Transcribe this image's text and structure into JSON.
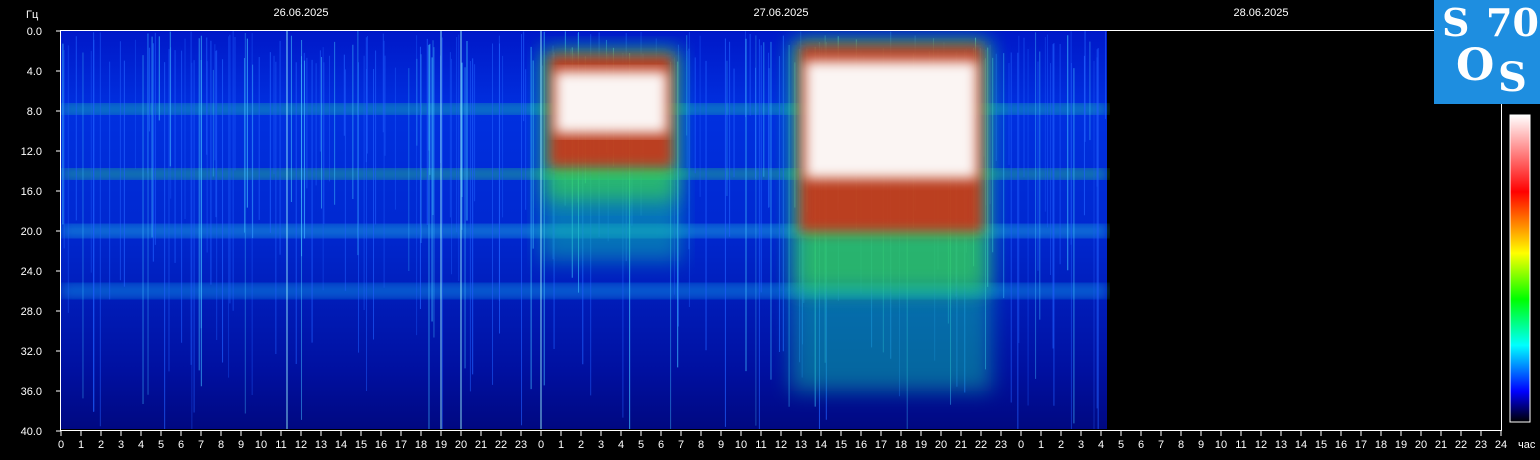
{
  "chart_data": {
    "type": "heatmap",
    "ylabel": "Гц",
    "xlabel": "час",
    "yticks": [
      "0.0",
      "4.0",
      "8.0",
      "12.0",
      "16.0",
      "20.0",
      "24.0",
      "28.0",
      "32.0",
      "36.0",
      "40.0"
    ],
    "ylim": [
      0,
      40
    ],
    "y_reversed": true,
    "dates": [
      "26.06.2025",
      "27.06.2025",
      "28.06.2025"
    ],
    "hour_ticks": [
      "0",
      "1",
      "2",
      "3",
      "4",
      "5",
      "6",
      "7",
      "8",
      "9",
      "10",
      "11",
      "12",
      "13",
      "14",
      "15",
      "16",
      "17",
      "18",
      "19",
      "20",
      "21",
      "22",
      "23",
      "0",
      "1",
      "2",
      "3",
      "4",
      "5",
      "6",
      "7",
      "8",
      "9",
      "10",
      "11",
      "12",
      "13",
      "14",
      "15",
      "16",
      "17",
      "18",
      "19",
      "20",
      "21",
      "22",
      "23",
      "0",
      "1",
      "2",
      "3",
      "4",
      "5",
      "6",
      "7",
      "8",
      "9",
      "10",
      "11",
      "12",
      "13",
      "14",
      "15",
      "16",
      "17",
      "18",
      "19",
      "20",
      "21",
      "22",
      "23",
      "24"
    ],
    "xlim_hours": [
      0,
      72
    ],
    "data_end_hour": 52.3,
    "bands_hz": [
      7.8,
      14.3,
      20.0,
      26.0
    ],
    "bursts": [
      {
        "start_hour": 24.0,
        "end_hour": 31.0,
        "from_hz": 2.0,
        "to_hz": 17.0,
        "peak": "white"
      },
      {
        "start_hour": 36.5,
        "end_hour": 46.5,
        "from_hz": 1.0,
        "to_hz": 26.0,
        "peak": "white"
      }
    ],
    "colorbar": [
      "#ffffff",
      "#ff0000",
      "#ffff00",
      "#00ff00",
      "#00ffff",
      "#0000ff",
      "#000000"
    ],
    "background": "#000000"
  },
  "logo": {
    "line1_a": "S",
    "line1_b": "70",
    "line2_a": "O",
    "line2_b": "S",
    "color": "#1e8ee0"
  }
}
